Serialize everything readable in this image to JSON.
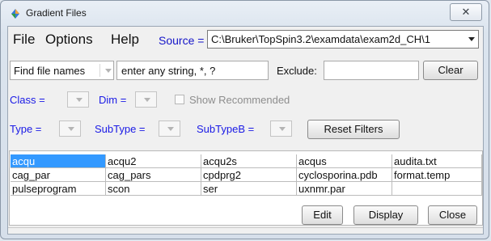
{
  "window": {
    "title": "Gradient Files",
    "close_glyph": "✕"
  },
  "menu": {
    "file": "File",
    "options": "Options",
    "help": "Help"
  },
  "source": {
    "label": "Source =",
    "value": "C:\\Bruker\\TopSpin3.2\\examdata\\exam2d_CH\\1"
  },
  "search": {
    "mode": "Find file names",
    "query": "enter any string, *, ?",
    "exclude_label": "Exclude:",
    "exclude_value": "",
    "clear_label": "Clear"
  },
  "filters": {
    "class_label": "Class =",
    "dim_label": "Dim =",
    "show_recommended": "Show Recommended",
    "type_label": "Type =",
    "subtype_label": "SubType =",
    "subtypeb_label": "SubTypeB =",
    "reset_label": "Reset Filters"
  },
  "files": {
    "rows": [
      [
        "acqu",
        "acqu2",
        "acqu2s",
        "acqus",
        "audita.txt"
      ],
      [
        "cag_par",
        "cag_pars",
        "cpdprg2",
        "cyclosporina.pdb",
        "format.temp"
      ],
      [
        "pulseprogram",
        "scon",
        "ser",
        "uxnmr.par",
        ""
      ]
    ],
    "selected": "acqu"
  },
  "footer": {
    "edit": "Edit",
    "display": "Display",
    "close": "Close"
  },
  "colors": {
    "accent_blue": "#1a1ae6",
    "selection": "#3399ff"
  }
}
